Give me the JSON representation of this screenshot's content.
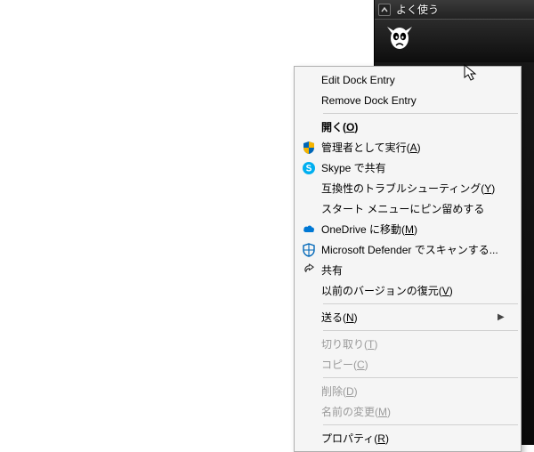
{
  "dock": {
    "header_label": "よく使う",
    "app_name": "foobar2000"
  },
  "menu": {
    "edit_dock_entry": "Edit Dock Entry",
    "remove_dock_entry": "Remove Dock Entry",
    "open": {
      "pre": "開く(",
      "hot": "O",
      "post": ")"
    },
    "run_as_admin": {
      "pre": "管理者として実行(",
      "hot": "A",
      "post": ")"
    },
    "skype_share": "Skype で共有",
    "compat_troubleshoot": {
      "pre": "互換性のトラブルシューティング(",
      "hot": "Y",
      "post": ")"
    },
    "pin_to_start": "スタート メニューにピン留めする",
    "move_to_onedrive": {
      "pre": "OneDrive に移動(",
      "hot": "M",
      "post": ")"
    },
    "defender_scan": "Microsoft Defender でスキャンする...",
    "share": "共有",
    "restore_previous": {
      "pre": "以前のバージョンの復元(",
      "hot": "V",
      "post": ")"
    },
    "send_to": {
      "pre": "送る(",
      "hot": "N",
      "post": ")"
    },
    "cut": {
      "pre": "切り取り(",
      "hot": "T",
      "post": ")"
    },
    "copy": {
      "pre": "コピー(",
      "hot": "C",
      "post": ")"
    },
    "delete": {
      "pre": "削除(",
      "hot": "D",
      "post": ")"
    },
    "rename": {
      "pre": "名前の変更(",
      "hot": "M",
      "post": ")"
    },
    "properties": {
      "pre": "プロパティ(",
      "hot": "R",
      "post": ")"
    }
  },
  "colors": {
    "skype_blue": "#00AFF0",
    "onedrive_blue": "#0078D4",
    "shield_blue": "#0067b8",
    "shield_yellow": "#f5b400"
  }
}
